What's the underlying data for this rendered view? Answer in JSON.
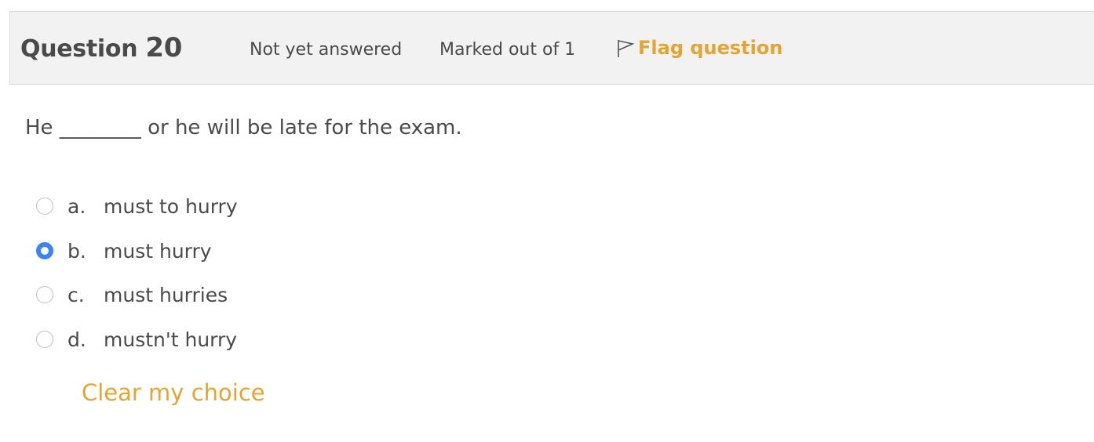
{
  "question": {
    "title_prefix": "Question",
    "number": "20",
    "state": "Not yet answered",
    "grade": "Marked out of 1",
    "flag_label": "Flag question",
    "text": "He ________ or he will be late for the exam."
  },
  "options": [
    {
      "letter": "a.",
      "text": "must to hurry",
      "selected": false
    },
    {
      "letter": "b.",
      "text": "must hurry",
      "selected": true
    },
    {
      "letter": "c.",
      "text": "must hurries",
      "selected": false
    },
    {
      "letter": "d.",
      "text": "mustn't hurry",
      "selected": false
    }
  ],
  "clear_choice_label": "Clear my choice",
  "colors": {
    "accent": "#e5a330",
    "radio_selected": "#3b82f6",
    "header_bg": "#f2f2f2"
  },
  "icons": {
    "flag": "flag-outline-icon"
  }
}
